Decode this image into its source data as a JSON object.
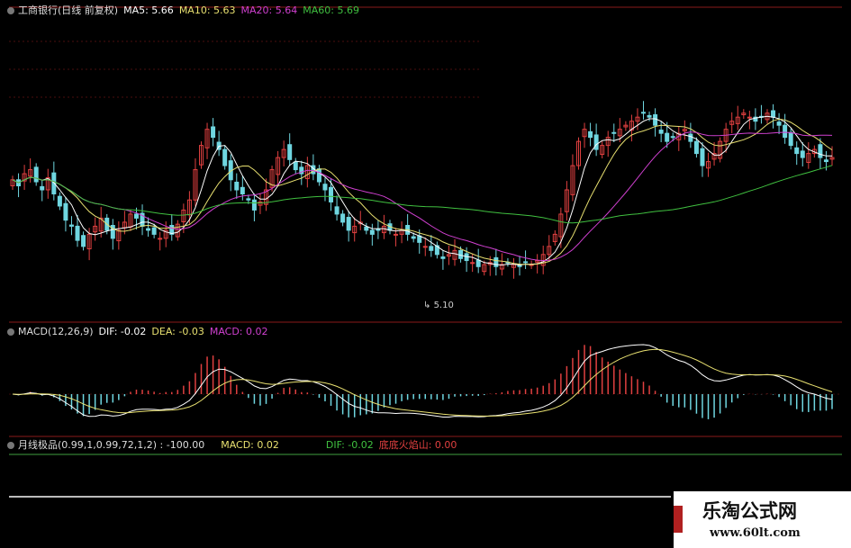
{
  "colors": {
    "up": "#e04040",
    "down": "#6fd6e0",
    "ma5": "#ffffff",
    "ma10": "#e8e070",
    "ma20": "#d040d0",
    "ma60": "#40c040",
    "dif": "#ffffff",
    "dea": "#e8e070",
    "macd": "#d040d0",
    "grid": "#8a1a1a"
  },
  "header_main": {
    "title": "工商银行(日线 前复权)",
    "ma5": "MA5: 5.66",
    "ma10": "MA10: 5.63",
    "ma20": "MA20: 5.64",
    "ma60": "MA60: 5.69"
  },
  "price_annotation": "5.10",
  "header_macd": {
    "title": "MACD(12,26,9)",
    "dif": "DIF: -0.02",
    "dea": "DEA: -0.03",
    "macd": "MACD: 0.02"
  },
  "header_custom": {
    "title": "月线极品(0.99,1,0.99,72,1,2) : -100.00",
    "macd": "MACD: 0.02",
    "dif": "DIF: -0.02",
    "volcano": "底底火焰山: 0.00"
  },
  "watermark": {
    "name": "乐淘公式网",
    "url": "www.60lt.com"
  },
  "chart_data": [
    {
      "type": "candlestick",
      "title": "工商银行(日线 前复权)",
      "low_annotation": 5.1,
      "ylim": [
        5.05,
        5.95
      ],
      "series_names": [
        "MA5",
        "MA10",
        "MA20",
        "MA60"
      ],
      "last_ma": {
        "MA5": 5.66,
        "MA10": 5.63,
        "MA20": 5.64,
        "MA60": 5.69
      },
      "close": [
        5.55,
        5.52,
        5.58,
        5.6,
        5.54,
        5.5,
        5.56,
        5.48,
        5.42,
        5.35,
        5.32,
        5.25,
        5.22,
        5.28,
        5.32,
        5.36,
        5.3,
        5.26,
        5.3,
        5.34,
        5.38,
        5.36,
        5.32,
        5.3,
        5.28,
        5.26,
        5.3,
        5.28,
        5.33,
        5.4,
        5.45,
        5.6,
        5.72,
        5.8,
        5.76,
        5.7,
        5.62,
        5.55,
        5.5,
        5.48,
        5.45,
        5.4,
        5.44,
        5.5,
        5.6,
        5.66,
        5.7,
        5.65,
        5.6,
        5.58,
        5.62,
        5.58,
        5.54,
        5.5,
        5.44,
        5.38,
        5.34,
        5.3,
        5.32,
        5.34,
        5.3,
        5.28,
        5.3,
        5.32,
        5.3,
        5.28,
        5.3,
        5.28,
        5.26,
        5.24,
        5.22,
        5.2,
        5.18,
        5.16,
        5.18,
        5.2,
        5.16,
        5.15,
        5.14,
        5.12,
        5.13,
        5.14,
        5.12,
        5.13,
        5.14,
        5.13,
        5.12,
        5.14,
        5.13,
        5.15,
        5.18,
        5.22,
        5.28,
        5.38,
        5.5,
        5.62,
        5.74,
        5.8,
        5.76,
        5.7,
        5.72,
        5.76,
        5.78,
        5.8,
        5.82,
        5.84,
        5.86,
        5.88,
        5.86,
        5.82,
        5.78,
        5.74,
        5.76,
        5.78,
        5.8,
        5.74,
        5.68,
        5.62,
        5.64,
        5.68,
        5.74,
        5.8,
        5.84,
        5.86,
        5.88,
        5.86,
        5.84,
        5.86,
        5.88,
        5.86,
        5.82,
        5.76,
        5.72,
        5.68,
        5.66,
        5.68,
        5.7,
        5.66,
        5.64,
        5.66
      ]
    },
    {
      "type": "bar+line",
      "title": "MACD(12,26,9)",
      "series_names": [
        "DIF",
        "DEA",
        "MACD"
      ],
      "last": {
        "DIF": -0.02,
        "DEA": -0.03,
        "MACD": 0.02
      }
    },
    {
      "type": "line",
      "title": "月线极品(0.99,1,0.99,72,1,2)",
      "values": {
        "月线极品": -100.0,
        "MACD": 0.02,
        "DIF": -0.02,
        "底底火焰山": 0.0
      }
    }
  ]
}
